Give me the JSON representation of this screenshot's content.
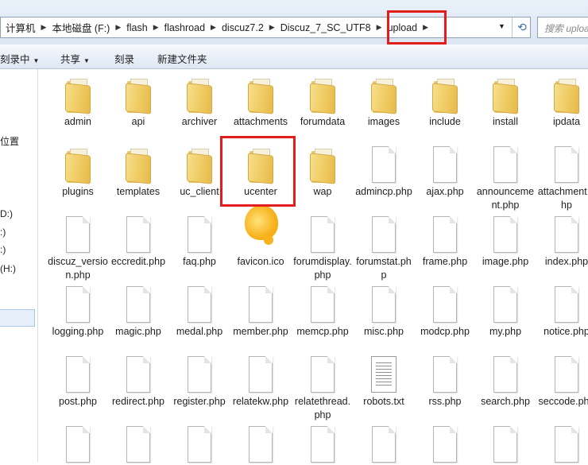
{
  "address_bar": {
    "crumbs": [
      "计算机",
      "本地磁盘 (F:)",
      "flash",
      "flashroad",
      "discuz7.2",
      "Discuz_7_SC_UTF8",
      "upload"
    ],
    "search_placeholder": "搜索 upload"
  },
  "toolbar": {
    "organize": "刻录中",
    "share": "共享",
    "burn": "刻录",
    "new_folder": "新建文件夹"
  },
  "nav_pane": {
    "items": [
      "位置",
      "D:)",
      ":)",
      ":)",
      "(H:)"
    ]
  },
  "files": [
    {
      "name": "admin",
      "type": "folder"
    },
    {
      "name": "api",
      "type": "folder"
    },
    {
      "name": "archiver",
      "type": "folder"
    },
    {
      "name": "attachments",
      "type": "folder"
    },
    {
      "name": "forumdata",
      "type": "folder"
    },
    {
      "name": "images",
      "type": "folder"
    },
    {
      "name": "include",
      "type": "folder"
    },
    {
      "name": "install",
      "type": "folder"
    },
    {
      "name": "ipdata",
      "type": "folder"
    },
    {
      "name": "plugins",
      "type": "folder"
    },
    {
      "name": "templates",
      "type": "folder"
    },
    {
      "name": "uc_client",
      "type": "folder"
    },
    {
      "name": "ucenter",
      "type": "folder"
    },
    {
      "name": "wap",
      "type": "folder"
    },
    {
      "name": "admincp.php",
      "type": "file"
    },
    {
      "name": "ajax.php",
      "type": "file"
    },
    {
      "name": "announcement.php",
      "type": "file"
    },
    {
      "name": "attachment.php",
      "type": "file"
    },
    {
      "name": "discuz_version.php",
      "type": "file"
    },
    {
      "name": "eccredit.php",
      "type": "file"
    },
    {
      "name": "faq.php",
      "type": "file"
    },
    {
      "name": "favicon.ico",
      "type": "favicon"
    },
    {
      "name": "forumdisplay.php",
      "type": "file"
    },
    {
      "name": "forumstat.php",
      "type": "file"
    },
    {
      "name": "frame.php",
      "type": "file"
    },
    {
      "name": "image.php",
      "type": "file"
    },
    {
      "name": "index.php",
      "type": "file"
    },
    {
      "name": "logging.php",
      "type": "file"
    },
    {
      "name": "magic.php",
      "type": "file"
    },
    {
      "name": "medal.php",
      "type": "file"
    },
    {
      "name": "member.php",
      "type": "file"
    },
    {
      "name": "memcp.php",
      "type": "file"
    },
    {
      "name": "misc.php",
      "type": "file"
    },
    {
      "name": "modcp.php",
      "type": "file"
    },
    {
      "name": "my.php",
      "type": "file"
    },
    {
      "name": "notice.php",
      "type": "file"
    },
    {
      "name": "post.php",
      "type": "file"
    },
    {
      "name": "redirect.php",
      "type": "file"
    },
    {
      "name": "register.php",
      "type": "file"
    },
    {
      "name": "relatekw.php",
      "type": "file"
    },
    {
      "name": "relatethread.php",
      "type": "file"
    },
    {
      "name": "robots.txt",
      "type": "text"
    },
    {
      "name": "rss.php",
      "type": "file"
    },
    {
      "name": "search.php",
      "type": "file"
    },
    {
      "name": "seccode.php",
      "type": "file"
    },
    {
      "name": "",
      "type": "file"
    },
    {
      "name": "",
      "type": "file"
    },
    {
      "name": "",
      "type": "file"
    },
    {
      "name": "",
      "type": "file"
    },
    {
      "name": "",
      "type": "file"
    },
    {
      "name": "",
      "type": "file"
    },
    {
      "name": "",
      "type": "file"
    },
    {
      "name": "",
      "type": "file"
    },
    {
      "name": "",
      "type": "file"
    }
  ],
  "colors": {
    "highlight": "#e31c1c"
  }
}
